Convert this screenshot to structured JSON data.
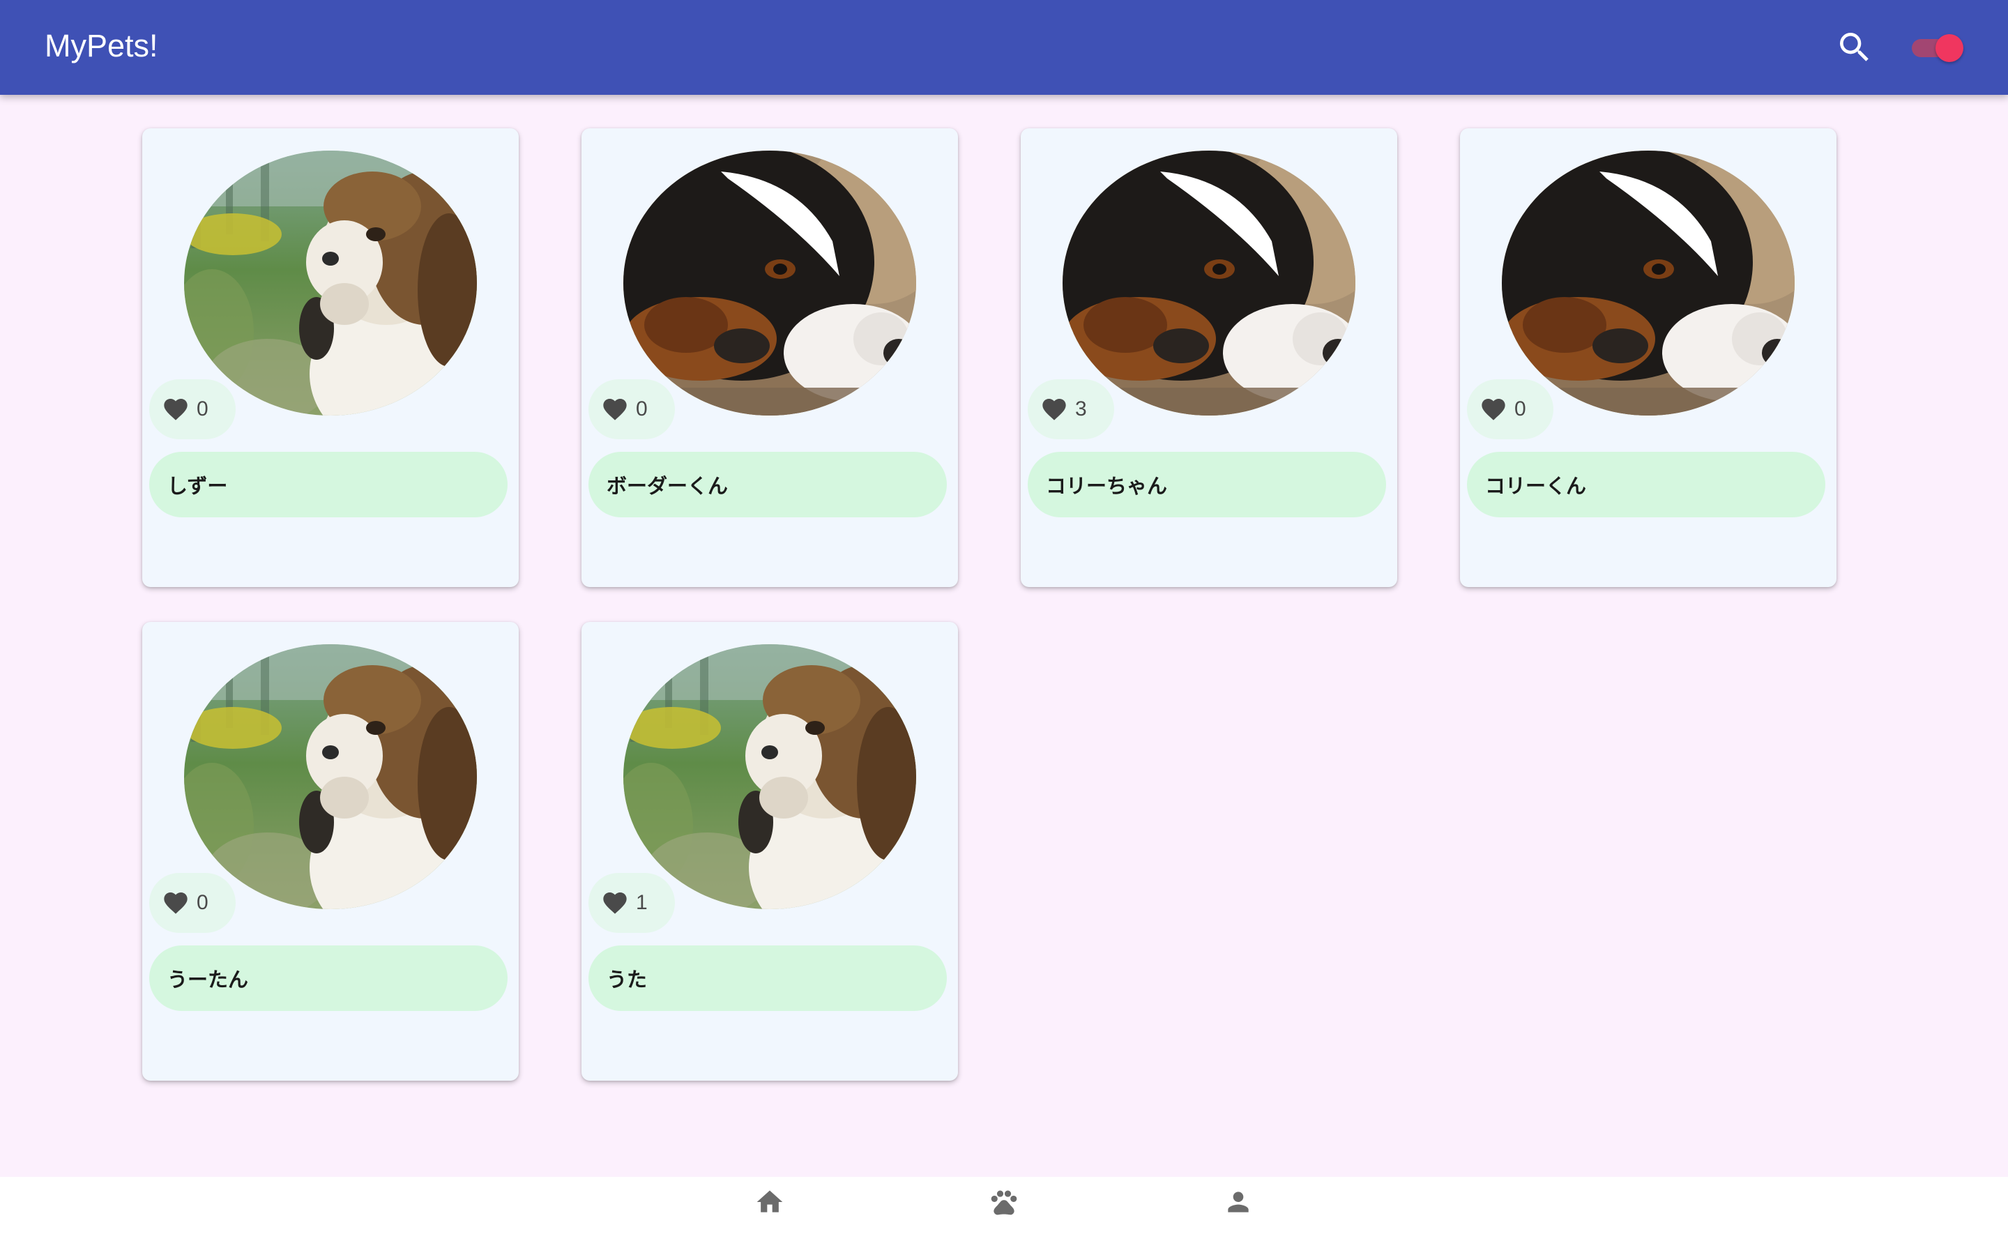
{
  "app": {
    "title": "MyPets!",
    "colors": {
      "app_bar": "#3f51b5",
      "page_background": "#fcf0fd",
      "card_background": "#f1f7fe",
      "name_chip": "#d5f7df",
      "like_chip": "#e5f7ee",
      "toggle_active": "#f0365f"
    }
  },
  "header": {
    "search_icon": "search-icon",
    "theme_toggle_on": true
  },
  "pets": [
    {
      "name": "しずー",
      "likes": "0",
      "photo": "shih-tzu"
    },
    {
      "name": "ボーダーくん",
      "likes": "0",
      "photo": "border-collie"
    },
    {
      "name": "コリーちゃん",
      "likes": "3",
      "photo": "border-collie"
    },
    {
      "name": "コリーくん",
      "likes": "0",
      "photo": "border-collie"
    },
    {
      "name": "うーたん",
      "likes": "0",
      "photo": "shih-tzu"
    },
    {
      "name": "うた",
      "likes": "1",
      "photo": "shih-tzu"
    }
  ],
  "bottom_nav": [
    {
      "icon": "home-icon"
    },
    {
      "icon": "paw-icon"
    },
    {
      "icon": "person-icon"
    }
  ]
}
